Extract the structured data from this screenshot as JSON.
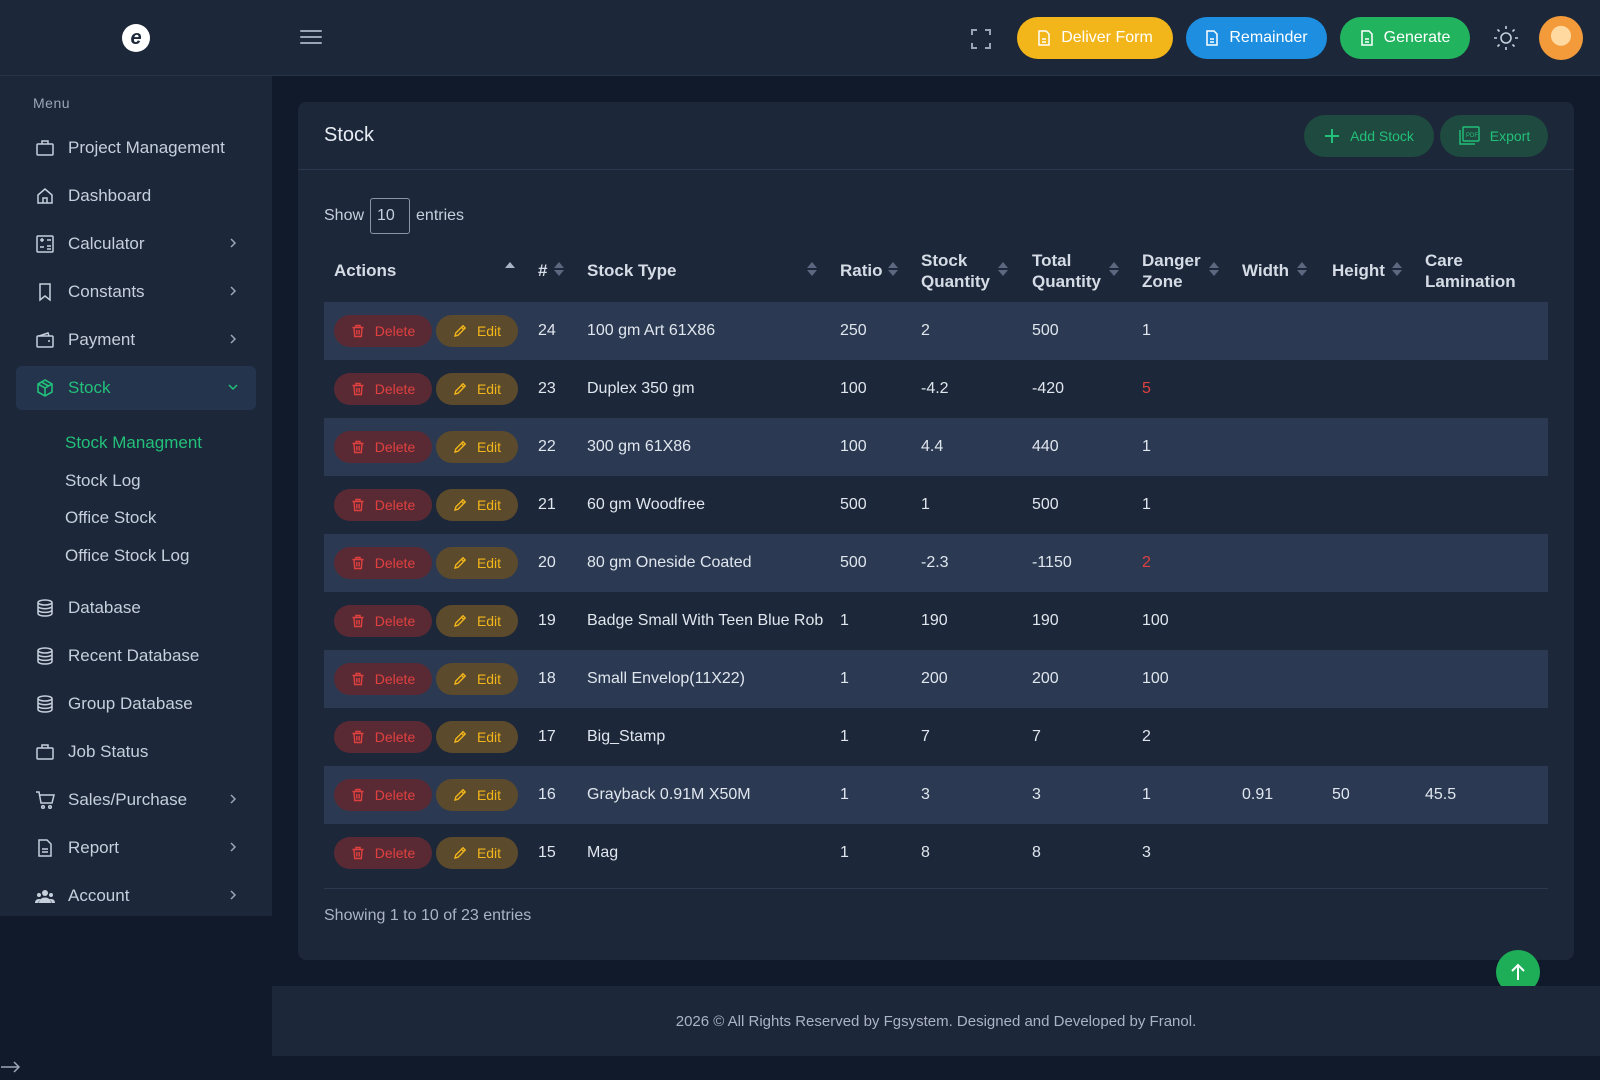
{
  "topbar": {
    "logo_letter": "e",
    "buttons": {
      "deliver": "Deliver Form",
      "remainder": "Remainder",
      "generate": "Generate"
    }
  },
  "sidebar": {
    "menu_label": "Menu",
    "items": [
      {
        "label": "Project Management",
        "icon": "briefcase-icon"
      },
      {
        "label": "Dashboard",
        "icon": "home-icon"
      },
      {
        "label": "Calculator",
        "icon": "calculator-icon",
        "has_children": true
      },
      {
        "label": "Constants",
        "icon": "bookmark-icon",
        "has_children": true
      },
      {
        "label": "Payment",
        "icon": "wallet-icon",
        "has_children": true
      },
      {
        "label": "Stock",
        "icon": "box-icon",
        "has_children": true,
        "active": true
      },
      {
        "label": "Database",
        "icon": "database-icon"
      },
      {
        "label": "Recent Database",
        "icon": "database-icon"
      },
      {
        "label": "Group Database",
        "icon": "database-icon"
      },
      {
        "label": "Job Status",
        "icon": "briefcase-icon"
      },
      {
        "label": "Sales/Purchase",
        "icon": "cart-icon",
        "has_children": true
      },
      {
        "label": "Report",
        "icon": "file-icon",
        "has_children": true
      },
      {
        "label": "Account",
        "icon": "users-icon",
        "has_children": true
      }
    ],
    "stock_submenu": [
      "Stock Managment",
      "Stock Log",
      "Office Stock",
      "Office Stock Log"
    ]
  },
  "card": {
    "title": "Stock",
    "add_label": "Add Stock",
    "export_label": "Export",
    "show_label": "Show",
    "entries_value": "10",
    "entries_label": "entries"
  },
  "table": {
    "headers": {
      "actions": "Actions",
      "num": "#",
      "stock_type": "Stock Type",
      "ratio": "Ratio",
      "stock_quantity_1": "Stock",
      "stock_quantity_2": "Quantity",
      "total_quantity_1": "Total",
      "total_quantity_2": "Quantity",
      "danger_zone_1": "Danger",
      "danger_zone_2": "Zone",
      "width": "Width",
      "height": "Height",
      "care_lamination_1": "Care",
      "care_lamination_2": "Lamination"
    },
    "delete_label": "Delete",
    "edit_label": "Edit",
    "rows": [
      {
        "id": "24",
        "type": "100 gm Art 61X86",
        "ratio": "250",
        "stock_qty": "2",
        "total_qty": "500",
        "danger": "1",
        "width": "",
        "height": "",
        "care": "",
        "danger_red": false
      },
      {
        "id": "23",
        "type": "Duplex 350 gm",
        "ratio": "100",
        "stock_qty": "-4.2",
        "total_qty": "-420",
        "danger": "5",
        "width": "",
        "height": "",
        "care": "",
        "danger_red": true
      },
      {
        "id": "22",
        "type": "300 gm 61X86",
        "ratio": "100",
        "stock_qty": "4.4",
        "total_qty": "440",
        "danger": "1",
        "width": "",
        "height": "",
        "care": "",
        "danger_red": false
      },
      {
        "id": "21",
        "type": "60 gm Woodfree",
        "ratio": "500",
        "stock_qty": "1",
        "total_qty": "500",
        "danger": "1",
        "width": "",
        "height": "",
        "care": "",
        "danger_red": false
      },
      {
        "id": "20",
        "type": "80 gm Oneside Coated",
        "ratio": "500",
        "stock_qty": "-2.3",
        "total_qty": "-1150",
        "danger": "2",
        "width": "",
        "height": "",
        "care": "",
        "danger_red": true
      },
      {
        "id": "19",
        "type": "Badge Small With Teen Blue Rob",
        "ratio": "1",
        "stock_qty": "190",
        "total_qty": "190",
        "danger": "100",
        "width": "",
        "height": "",
        "care": "",
        "danger_red": false
      },
      {
        "id": "18",
        "type": "Small Envelop(11X22)",
        "ratio": "1",
        "stock_qty": "200",
        "total_qty": "200",
        "danger": "100",
        "width": "",
        "height": "",
        "care": "",
        "danger_red": false
      },
      {
        "id": "17",
        "type": "Big_Stamp",
        "ratio": "1",
        "stock_qty": "7",
        "total_qty": "7",
        "danger": "2",
        "width": "",
        "height": "",
        "care": "",
        "danger_red": false
      },
      {
        "id": "16",
        "type": "Grayback 0.91M X50M",
        "ratio": "1",
        "stock_qty": "3",
        "total_qty": "3",
        "danger": "1",
        "width": "0.91",
        "height": "50",
        "care": "45.5",
        "danger_red": false
      },
      {
        "id": "15",
        "type": "Mag",
        "ratio": "1",
        "stock_qty": "8",
        "total_qty": "8",
        "danger": "3",
        "width": "",
        "height": "",
        "care": "",
        "danger_red": false
      }
    ],
    "showing_text": "Showing 1 to 10 of 23 entries"
  },
  "footer": {
    "text": "2026 © All Rights Reserved by Fgsystem. Designed and Developed by Franol."
  },
  "colors": {
    "accent_green": "#22c07a",
    "danger_red": "#e0413f",
    "warning_yellow": "#f2b51a",
    "info_blue": "#1d8ee0"
  }
}
